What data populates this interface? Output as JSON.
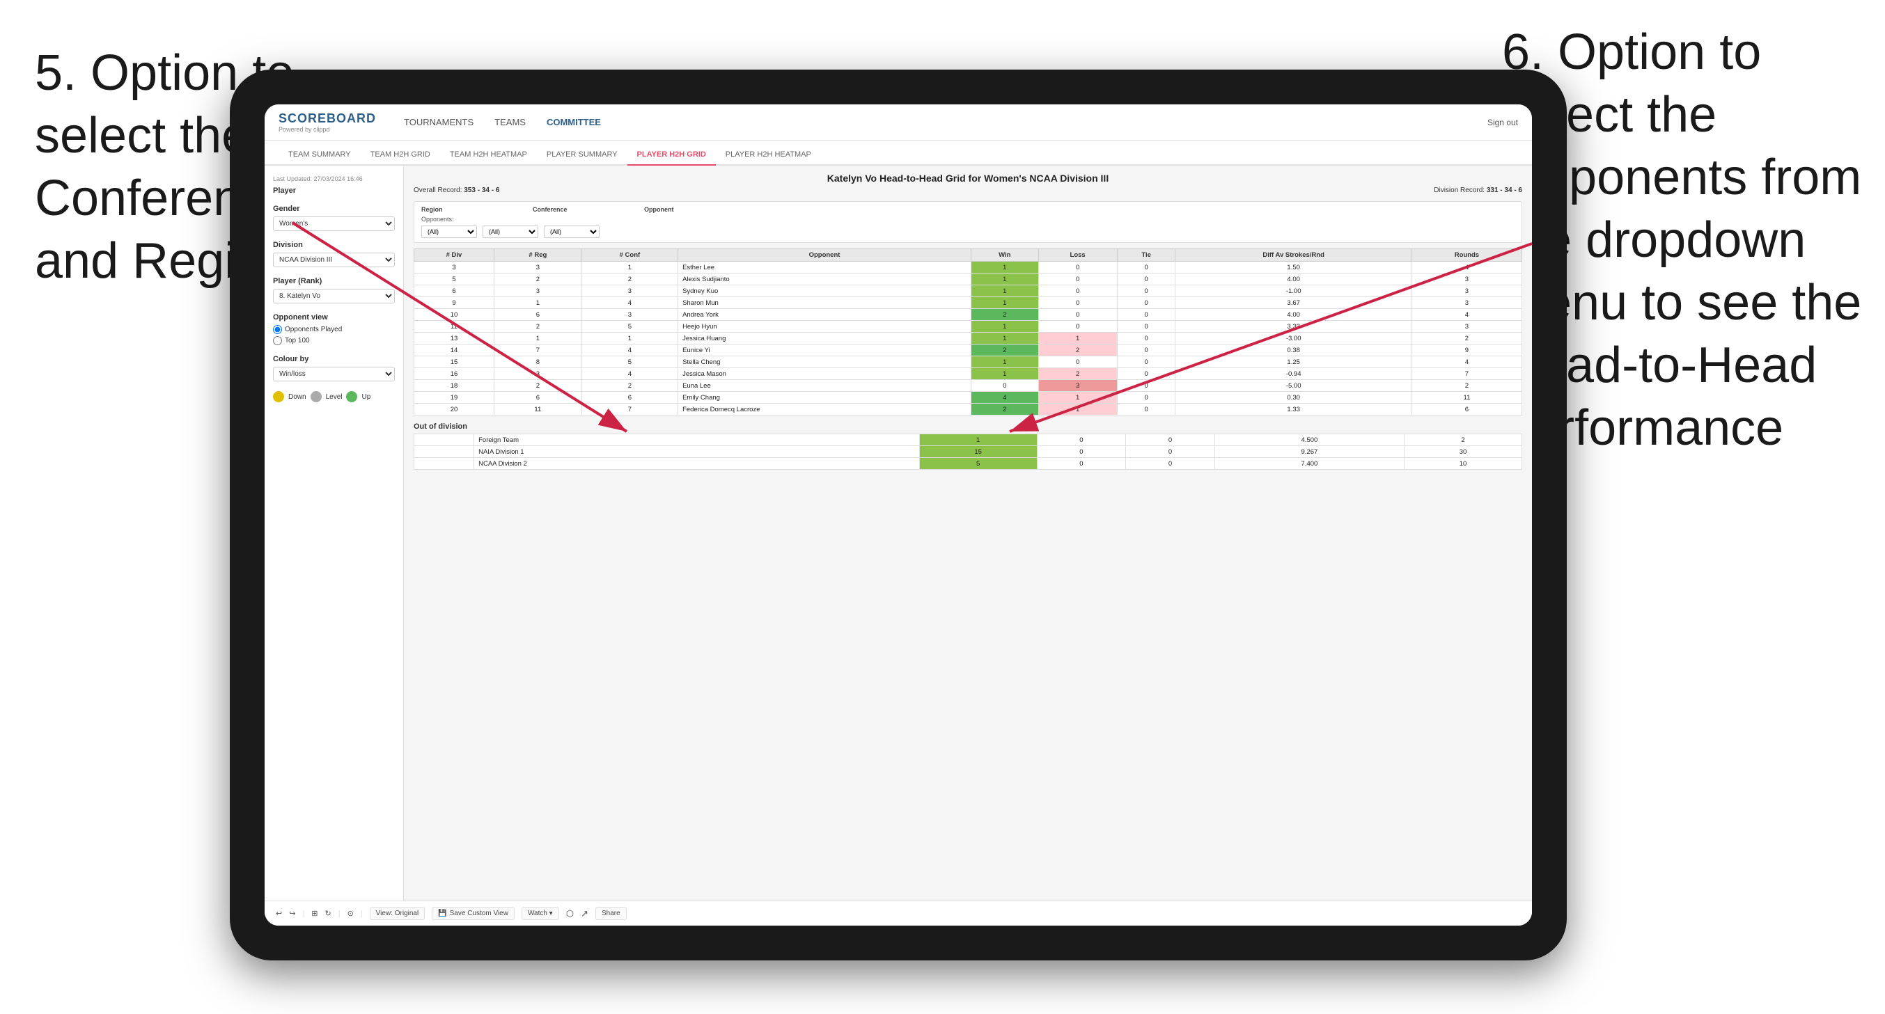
{
  "annotations": {
    "left": {
      "text": "5. Option to select the Conference and Region"
    },
    "right": {
      "text": "6. Option to select the Opponents from the dropdown menu to see the Head-to-Head performance"
    }
  },
  "nav": {
    "logo": "SCOREBOARD",
    "logo_sub": "Powered by clippd",
    "items": [
      "TOURNAMENTS",
      "TEAMS",
      "COMMITTEE"
    ],
    "active_item": "COMMITTEE",
    "sign_out": "Sign out"
  },
  "sub_nav": {
    "items": [
      "TEAM SUMMARY",
      "TEAM H2H GRID",
      "TEAM H2H HEATMAP",
      "PLAYER SUMMARY",
      "PLAYER H2H GRID",
      "PLAYER H2H HEATMAP"
    ],
    "active_item": "PLAYER H2H GRID"
  },
  "sidebar": {
    "last_updated": "Last Updated: 27/03/2024 16:46",
    "player_label": "Player",
    "gender_label": "Gender",
    "gender_value": "Women's",
    "division_label": "Division",
    "division_value": "NCAA Division III",
    "player_rank_label": "Player (Rank)",
    "player_rank_value": "8. Katelyn Vo",
    "opponent_view_label": "Opponent view",
    "opponent_played": "Opponents Played",
    "top_100": "Top 100",
    "colour_by_label": "Colour by",
    "colour_by_value": "Win/loss",
    "legend_down": "Down",
    "legend_level": "Level",
    "legend_up": "Up"
  },
  "grid": {
    "title": "Katelyn Vo Head-to-Head Grid for Women's NCAA Division III",
    "overall_record_label": "Overall Record:",
    "overall_record": "353 - 34 - 6",
    "division_record_label": "Division Record:",
    "division_record": "331 - 34 - 6",
    "filter": {
      "region_label": "Region",
      "conference_label": "Conference",
      "opponent_label": "Opponent",
      "opponents_label": "Opponents:",
      "region_value": "(All)",
      "conference_value": "(All)",
      "opponent_value": "(All)"
    },
    "table_headers": [
      "# Div",
      "# Reg",
      "# Conf",
      "Opponent",
      "Win",
      "Loss",
      "Tie",
      "Diff Av Strokes/Rnd",
      "Rounds"
    ],
    "rows": [
      {
        "div": "3",
        "reg": "3",
        "conf": "1",
        "opponent": "Esther Lee",
        "win": "1",
        "loss": "0",
        "tie": "0",
        "diff": "1.50",
        "rounds": "4",
        "win_color": "green",
        "loss_color": "white",
        "tie_color": "white"
      },
      {
        "div": "5",
        "reg": "2",
        "conf": "2",
        "opponent": "Alexis Sudjianto",
        "win": "1",
        "loss": "0",
        "tie": "0",
        "diff": "4.00",
        "rounds": "3",
        "win_color": "green",
        "loss_color": "white",
        "tie_color": "white"
      },
      {
        "div": "6",
        "reg": "3",
        "conf": "3",
        "opponent": "Sydney Kuo",
        "win": "1",
        "loss": "0",
        "tie": "0",
        "diff": "-1.00",
        "rounds": "3",
        "win_color": "green",
        "loss_color": "white",
        "tie_color": "white"
      },
      {
        "div": "9",
        "reg": "1",
        "conf": "4",
        "opponent": "Sharon Mun",
        "win": "1",
        "loss": "0",
        "tie": "0",
        "diff": "3.67",
        "rounds": "3",
        "win_color": "green",
        "loss_color": "white",
        "tie_color": "white"
      },
      {
        "div": "10",
        "reg": "6",
        "conf": "3",
        "opponent": "Andrea York",
        "win": "2",
        "loss": "0",
        "tie": "0",
        "diff": "4.00",
        "rounds": "4",
        "win_color": "green_bright",
        "loss_color": "white",
        "tie_color": "white"
      },
      {
        "div": "11",
        "reg": "2",
        "conf": "5",
        "opponent": "Heejo Hyun",
        "win": "1",
        "loss": "0",
        "tie": "0",
        "diff": "3.33",
        "rounds": "3",
        "win_color": "green",
        "loss_color": "white",
        "tie_color": "white"
      },
      {
        "div": "13",
        "reg": "1",
        "conf": "1",
        "opponent": "Jessica Huang",
        "win": "1",
        "loss": "1",
        "tie": "0",
        "diff": "-3.00",
        "rounds": "2",
        "win_color": "green",
        "loss_color": "red",
        "tie_color": "white"
      },
      {
        "div": "14",
        "reg": "7",
        "conf": "4",
        "opponent": "Eunice Yi",
        "win": "2",
        "loss": "2",
        "tie": "0",
        "diff": "0.38",
        "rounds": "9",
        "win_color": "green_bright",
        "loss_color": "red",
        "tie_color": "white"
      },
      {
        "div": "15",
        "reg": "8",
        "conf": "5",
        "opponent": "Stella Cheng",
        "win": "1",
        "loss": "0",
        "tie": "0",
        "diff": "1.25",
        "rounds": "4",
        "win_color": "green",
        "loss_color": "white",
        "tie_color": "white"
      },
      {
        "div": "16",
        "reg": "3",
        "conf": "4",
        "opponent": "Jessica Mason",
        "win": "1",
        "loss": "2",
        "tie": "0",
        "diff": "-0.94",
        "rounds": "7",
        "win_color": "green",
        "loss_color": "red",
        "tie_color": "white"
      },
      {
        "div": "18",
        "reg": "2",
        "conf": "2",
        "opponent": "Euna Lee",
        "win": "0",
        "loss": "3",
        "tie": "0",
        "diff": "-5.00",
        "rounds": "2",
        "win_color": "white",
        "loss_color": "red_bright",
        "tie_color": "white"
      },
      {
        "div": "19",
        "reg": "6",
        "conf": "6",
        "opponent": "Emily Chang",
        "win": "4",
        "loss": "1",
        "tie": "0",
        "diff": "0.30",
        "rounds": "11",
        "win_color": "green_bright",
        "loss_color": "red",
        "tie_color": "white"
      },
      {
        "div": "20",
        "reg": "11",
        "conf": "7",
        "opponent": "Federica Domecq Lacroze",
        "win": "2",
        "loss": "1",
        "tie": "0",
        "diff": "1.33",
        "rounds": "6",
        "win_color": "green_bright",
        "loss_color": "red",
        "tie_color": "white"
      }
    ],
    "out_of_division_title": "Out of division",
    "out_of_division_rows": [
      {
        "opponent": "Foreign Team",
        "win": "1",
        "loss": "0",
        "tie": "0",
        "diff": "4.500",
        "rounds": "2"
      },
      {
        "opponent": "NAIA Division 1",
        "win": "15",
        "loss": "0",
        "tie": "0",
        "diff": "9.267",
        "rounds": "30"
      },
      {
        "opponent": "NCAA Division 2",
        "win": "5",
        "loss": "0",
        "tie": "0",
        "diff": "7.400",
        "rounds": "10"
      }
    ]
  },
  "toolbar": {
    "undo_label": "↩",
    "redo_label": "↪",
    "view_original": "View: Original",
    "save_custom": "Save Custom View",
    "watch": "Watch ▾",
    "share": "Share"
  },
  "legend_colors": {
    "down": "#e0c000",
    "level": "#aaaaaa",
    "up": "#5cb85c"
  }
}
